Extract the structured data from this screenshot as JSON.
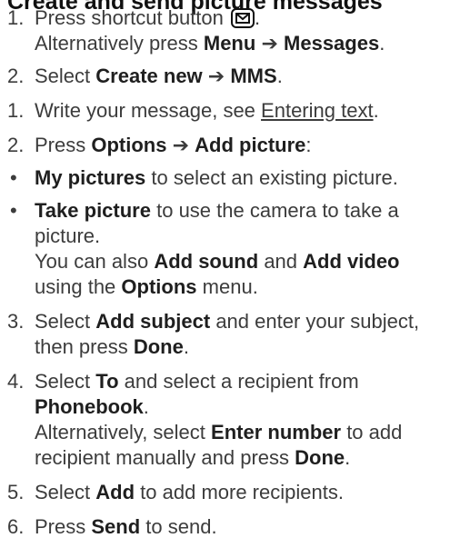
{
  "title": "Create and send picture messages",
  "steps": {
    "s1": {
      "num": "1.",
      "text": "Press shortcut button",
      "icon": "envelope-key-icon",
      "after_icon": ".",
      "alt_prefix": "Alternatively press",
      "alt_menu": "Menu",
      "arrow": "➔",
      "alt_target": "Messages",
      "alt_end": "."
    },
    "s2": {
      "num": "2.",
      "text": "Select",
      "a": "Create new",
      "arrow": "➔",
      "b": "MMS",
      "end": "."
    },
    "s3": {
      "num": "1.",
      "text": "Write your message, see",
      "link": "Entering text",
      "end": "."
    },
    "s4": {
      "num": "2.",
      "text": "Press",
      "a": "Options",
      "arrow": "➔",
      "b": "Add picture",
      "end": ":"
    },
    "b1": {
      "bullet": "•",
      "bold": "My pictures",
      "text": "to select an existing picture."
    },
    "b2": {
      "bullet": "•",
      "bold": "Take picture",
      "text": "to use the camera to take a picture.",
      "note_prefix": "You can also",
      "note_a": "Add sound",
      "note_and": "and",
      "note_b": "Add video",
      "note_mid": "using the",
      "note_c": "Options",
      "note_end": "menu."
    },
    "s5": {
      "num": "3.",
      "text": "Select",
      "a": "Add subject",
      "mid": "and enter your subject, then press",
      "b": "Done",
      "end": "."
    },
    "s6": {
      "num": "4.",
      "text": "Select",
      "a": "To",
      "mid": "and select a recipient from",
      "b": "Phonebook",
      "end": ".",
      "alt_prefix": "Alternatively, select",
      "alt_a": "Enter number",
      "alt_mid": "to add recipient manually and press",
      "alt_b": "Done",
      "alt_end": "."
    },
    "s7": {
      "num": "5.",
      "text": "Select",
      "a": "Add",
      "mid": "to add more recipients."
    },
    "s8": {
      "num": "6.",
      "text": "Press",
      "a": "Send",
      "mid": "to send."
    }
  }
}
